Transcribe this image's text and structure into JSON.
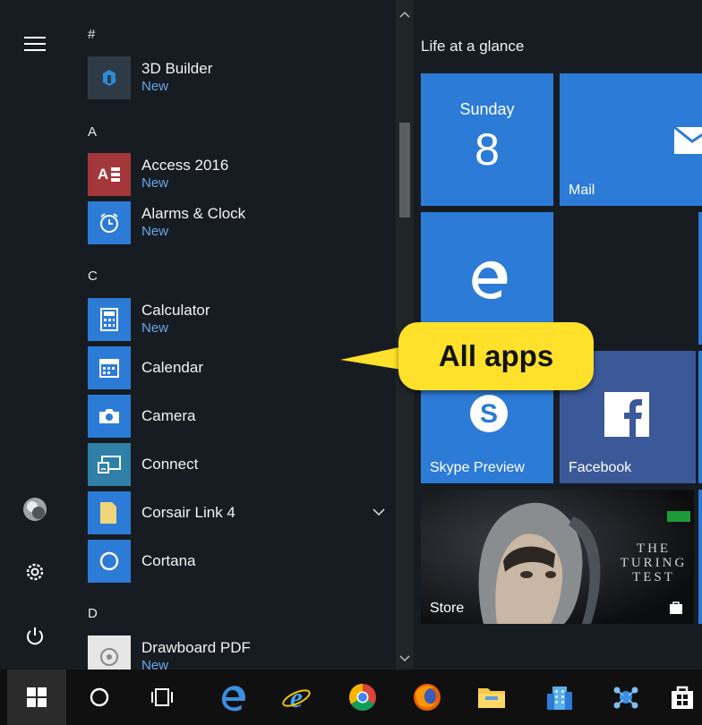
{
  "apps_list": {
    "sections": [
      {
        "letter": "#"
      },
      {
        "letter": "A"
      },
      {
        "letter": "C"
      },
      {
        "letter": "D"
      }
    ],
    "items": [
      {
        "name": "3D Builder",
        "sub": "New",
        "icon": "3d-builder-icon",
        "color": "#2e3b47"
      },
      {
        "name": "Access 2016",
        "sub": "New",
        "icon": "access-icon",
        "color": "#a4373a"
      },
      {
        "name": "Alarms & Clock",
        "sub": "New",
        "icon": "alarm-clock-icon",
        "color": "#2c7bd6"
      },
      {
        "name": "Calculator",
        "sub": "New",
        "icon": "calculator-icon",
        "color": "#2c7bd6"
      },
      {
        "name": "Calendar",
        "sub": "",
        "icon": "calendar-icon",
        "color": "#2c7bd6"
      },
      {
        "name": "Camera",
        "sub": "",
        "icon": "camera-icon",
        "color": "#2c7bd6"
      },
      {
        "name": "Connect",
        "sub": "",
        "icon": "connect-icon",
        "color": "#2f7fa6"
      },
      {
        "name": "Corsair Link 4",
        "sub": "",
        "icon": "folder-icon",
        "color": "#2c7bd6"
      },
      {
        "name": "Cortana",
        "sub": "",
        "icon": "cortana-icon",
        "color": "#2c7bd6"
      },
      {
        "name": "Drawboard PDF",
        "sub": "New",
        "icon": "drawboard-icon",
        "color": "#e6e6e6"
      }
    ]
  },
  "tiles_group": {
    "title": "Life at a glance"
  },
  "tiles": {
    "calendar": {
      "day": "Sunday",
      "date": "8"
    },
    "mail": {
      "label": "Mail"
    },
    "edge": {
      "label": ""
    },
    "skype": {
      "label": "Skype Preview"
    },
    "facebook": {
      "label": "Facebook"
    },
    "store": {
      "label": "Store",
      "art_title": "THE TURING TEST"
    }
  },
  "callout": {
    "text": "All apps"
  },
  "colors": {
    "accent": "#2c7bd6",
    "callout": "#ffe02a",
    "facebook": "#3b5998"
  }
}
